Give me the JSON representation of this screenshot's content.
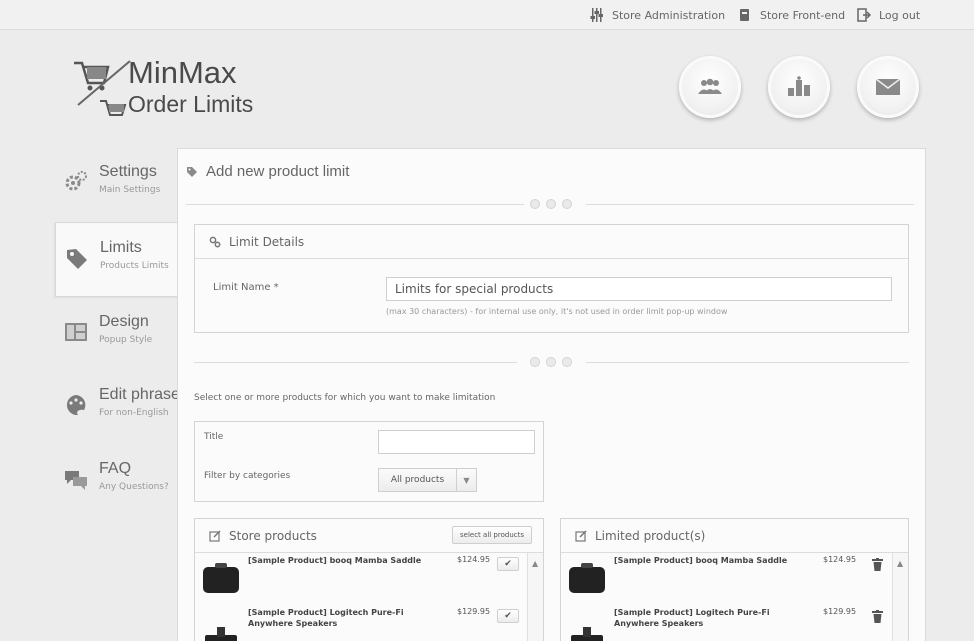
{
  "topbar": {
    "admin_label": "Store Administration",
    "frontend_label": "Store Front-end",
    "logout_label": "Log out"
  },
  "logo": {
    "line1": "MinMax",
    "line2": "Order Limits"
  },
  "nav": [
    {
      "title": "Settings",
      "sub": "Main Settings"
    },
    {
      "title": "Limits",
      "sub": "Products Limits"
    },
    {
      "title": "Design",
      "sub": "Popup Style"
    },
    {
      "title": "Edit phrases",
      "sub": "For non-English"
    },
    {
      "title": "FAQ",
      "sub": "Any Questions?"
    }
  ],
  "panel": {
    "title": "Add new product limit",
    "details_title": "Limit Details",
    "limit_name_label": "Limit Name *",
    "limit_name_value": "Limits for special products",
    "limit_name_hint": "(max 30 characters) - for internal use only, it's not used in order limit pop-up window",
    "select_instruction": "Select one or more products for which you want to make limitation",
    "filter": {
      "title_label": "Title",
      "title_value": "",
      "category_label": "Filter by categories",
      "category_value": "All products"
    },
    "store_products": {
      "title": "Store products",
      "select_all_label": "select all products",
      "items": [
        {
          "name": "[Sample Product] booq Mamba Saddle",
          "price": "$124.95"
        },
        {
          "name": "[Sample Product] Logitech Pure-Fi Anywhere Speakers",
          "price": "$129.95"
        }
      ]
    },
    "limited_products": {
      "title": "Limited product(s)",
      "items": [
        {
          "name": "[Sample Product] booq Mamba Saddle",
          "price": "$124.95"
        },
        {
          "name": "[Sample Product] Logitech Pure-Fi Anywhere Speakers",
          "price": "$129.95"
        }
      ]
    }
  }
}
